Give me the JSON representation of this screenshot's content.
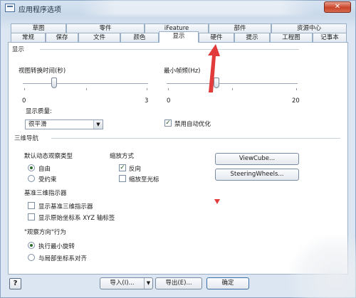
{
  "window": {
    "title": "应用程序选项",
    "close_glyph": "✕"
  },
  "tabs_row1": [
    "草图",
    "零件",
    "iFeature",
    "部件",
    "资源中心"
  ],
  "tabs_row2": [
    "常规",
    "保存",
    "文件",
    "颜色",
    "显示",
    "硬件",
    "提示",
    "工程图",
    "记事本"
  ],
  "active_tab": "显示",
  "display": {
    "section": "显示",
    "view_transition_label": "视图转换时间(秒)",
    "view_transition_min": "0",
    "view_transition_max": "3",
    "view_transition_value": 0.25,
    "min_fps_label": "最小帧频(Hz)",
    "min_fps_min": "0",
    "min_fps_max": "20",
    "min_fps_value": 0.38,
    "quality_label": "显示质量:",
    "quality_value": "很平滑",
    "disable_auto_refine_label": "禁用自动优化",
    "disable_auto_refine_checked": true
  },
  "navigation": {
    "section": "三维导航",
    "default_orbit_label": "默认动态观察类型",
    "orbit_free": "自由",
    "orbit_constrained": "受约束",
    "zoom_label": "缩放方式",
    "zoom_reverse": "反向",
    "zoom_reverse_checked": true,
    "zoom_to_cursor": "缩放至光标",
    "zoom_to_cursor_checked": false,
    "viewcube_button": "ViewCube...",
    "steeringwheels_button": "SteeringWheels...",
    "base_indicator_label": "基准三维指示器",
    "show_base_indicator": "显示基准三维指示器",
    "show_origin_axes": "显示原始坐标系 XYZ 轴标签",
    "look_at_label": "\"观察方向\"行为",
    "min_rotation": "执行最小旋转",
    "align_local": "与局部坐标系对齐"
  },
  "footer": {
    "help_glyph": "?",
    "import_button": "导入(I)...",
    "export_button": "导出(E)...",
    "ok_button": "确定",
    "dropdown_arrow": "▼"
  },
  "colors": {
    "annotation_red": "#e23b3b",
    "window_bg": "#dfe8f1"
  }
}
